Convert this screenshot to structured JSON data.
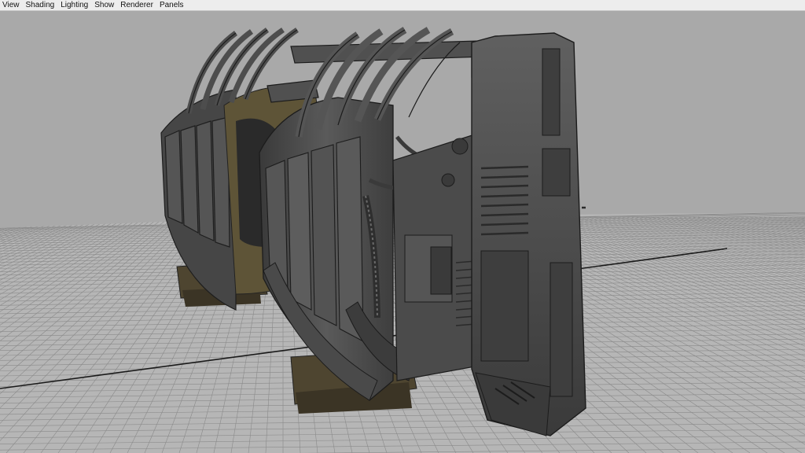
{
  "menubar": {
    "items": [
      "View",
      "Shading",
      "Lighting",
      "Show",
      "Renderer",
      "Panels"
    ]
  },
  "viewport": {
    "background_color": "#a9a9a9",
    "grid_color": "#8a8a8a",
    "axis_line_color": "#1a1a1a",
    "model_color": "#4a4a4a",
    "interior_color": "#5e5437"
  }
}
